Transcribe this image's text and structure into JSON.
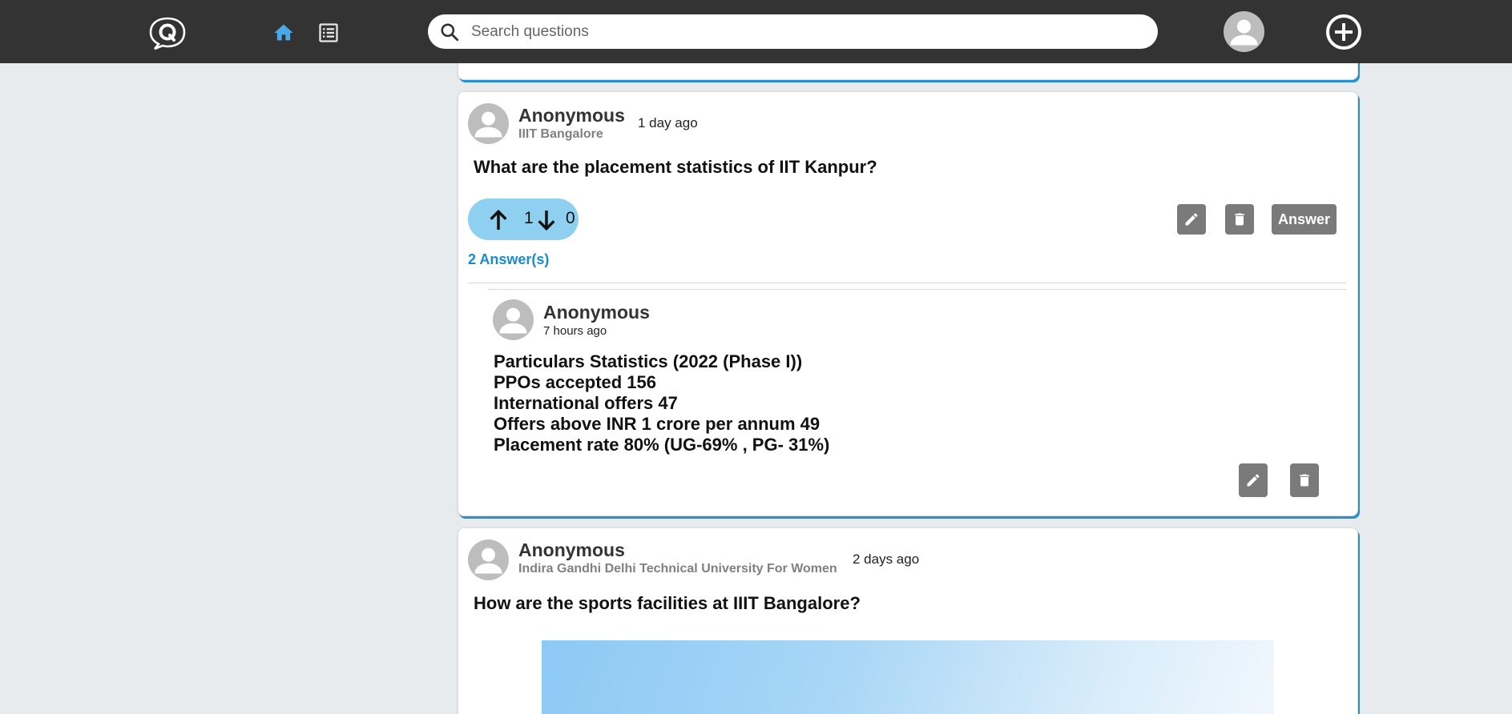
{
  "navbar": {
    "search_placeholder": "Search questions",
    "accent_color": "#4aa8e8"
  },
  "feed": {
    "current": {
      "author": "Anonymous",
      "org": "IIIT Bangalore",
      "time": "1 day ago",
      "question": "What are the placement statistics of IIT Kanpur?",
      "upvotes": "1",
      "downvotes": "0",
      "answer_label": "Answer",
      "answers_count_label": "2 Answer(s)",
      "answer": {
        "author": "Anonymous",
        "time": "7 hours ago",
        "lines": [
          "Particulars Statistics (2022 (Phase I))",
          "PPOs accepted 156",
          "International offers 47",
          "Offers above INR 1 crore per annum 49",
          "Placement rate 80% (UG-69% , PG- 31%)"
        ]
      }
    },
    "next": {
      "author": "Anonymous",
      "org": "Indira Gandhi Delhi Technical University For Women",
      "time": "2 days ago",
      "question": "How are the sports facilities at IIIT Bangalore?"
    }
  },
  "icons": [
    "quora-logo-icon",
    "home-icon",
    "list-icon",
    "search-icon",
    "avatar-icon",
    "add-circle-icon",
    "arrow-up-icon",
    "arrow-down-icon",
    "pencil-icon",
    "trash-icon"
  ]
}
